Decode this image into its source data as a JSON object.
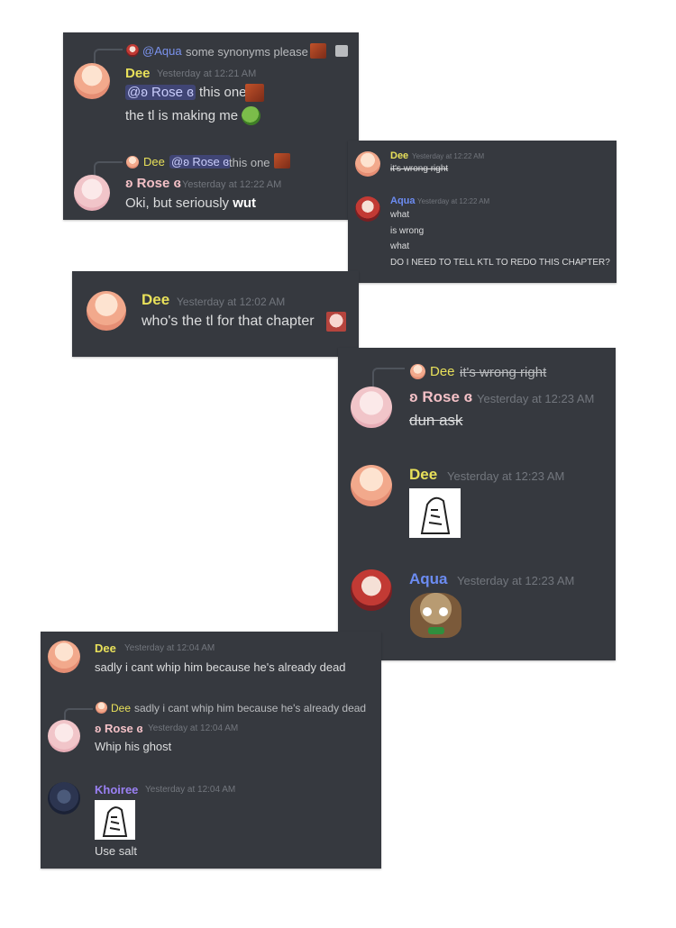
{
  "p1": {
    "reply_mention": "@Aqua",
    "reply_text": "some synonyms please",
    "m1_name": "Dee",
    "m1_time": "Yesterday at 12:21 AM",
    "m1_mention": "@ʚ Rose ɞ",
    "m1_line1": "this one",
    "m1_line2": "the tl is making me",
    "reply2_name": "Dee",
    "reply2_mention": "@ʚ Rose ɞ",
    "reply2_text": "this one",
    "m2_name": "ʚ Rose ɞ",
    "m2_time": "Yesterday at 12:22 AM",
    "m2_text": "Oki, but seriously",
    "m2_bold": "wut"
  },
  "p2": {
    "m1_name": "Dee",
    "m1_time": "Yesterday at 12:22 AM",
    "m1_text": "it's wrong right",
    "m2_name": "Aqua",
    "m2_time": "Yesterday at 12:22 AM",
    "lines": [
      "what",
      "is wrong",
      "what",
      "DO I NEED TO TELL KTL TO REDO THIS CHAPTER?"
    ]
  },
  "p3": {
    "name": "Dee",
    "time": "Yesterday at 12:02 AM",
    "text": "who's the tl for that chapter"
  },
  "p4": {
    "reply_name": "Dee",
    "reply_text": "it's wrong right",
    "m1_name": "ʚ Rose ɞ",
    "m1_time": "Yesterday at 12:23 AM",
    "m1_text": "dun ask",
    "m2_name": "Dee",
    "m2_time": "Yesterday at 12:23 AM",
    "m3_name": "Aqua",
    "m3_time": "Yesterday at 12:23 AM"
  },
  "p5": {
    "m1_name": "Dee",
    "m1_time": "Yesterday at 12:04 AM",
    "m1_text": "sadly i cant whip him because he's already dead",
    "reply_name": "Dee",
    "reply_text": "sadly i cant whip him because he's already dead",
    "m2_name": "ʚ Rose ɞ",
    "m2_time": "Yesterday at 12:04 AM",
    "m2_text": "Whip his ghost",
    "m3_name": "Khoiree",
    "m3_time": "Yesterday at 12:04 AM",
    "m3_text": "Use salt"
  },
  "colors": {
    "panel_bg": "#36393f",
    "dee": "#e8e05a",
    "rose": "#f3c0c6",
    "aqua": "#6c8cf2",
    "khoiree": "#9a80f3",
    "timestamp": "#72767d",
    "text": "#dcddde"
  }
}
